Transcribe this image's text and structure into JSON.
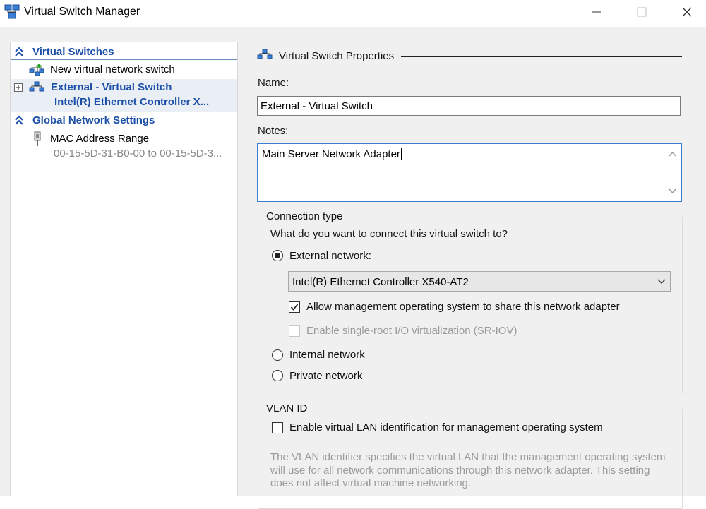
{
  "window": {
    "title": "Virtual Switch Manager",
    "controls": {
      "minimize_icon": "minimize-icon",
      "maximize_icon": "maximize-icon",
      "close_icon": "close-icon"
    }
  },
  "tree": {
    "virtual_switches_label": "Virtual Switches",
    "new_switch_label": "New virtual network switch",
    "switch": {
      "name": "External - Virtual Switch",
      "adapter": "Intel(R) Ethernet Controller X..."
    },
    "global_settings_label": "Global Network Settings",
    "mac_range": {
      "label": "MAC Address Range",
      "value": "00-15-5D-31-B0-00 to 00-15-5D-3..."
    }
  },
  "properties": {
    "header": "Virtual Switch Properties",
    "name_label": "Name:",
    "name_value": "External - Virtual Switch",
    "notes_label": "Notes:",
    "notes_value": "Main Server Network Adapter",
    "connection": {
      "title": "Connection type",
      "question": "What do you want to connect this virtual switch to?",
      "external_label": "External network:",
      "adapter_selected": "Intel(R) Ethernet Controller X540-AT2",
      "allow_mgmt_label": "Allow management operating system to share this network adapter",
      "sriov_label": "Enable single-root I/O virtualization (SR-IOV)",
      "internal_label": "Internal network",
      "private_label": "Private network",
      "selected": "external"
    },
    "vlan": {
      "title": "VLAN ID",
      "enable_label": "Enable virtual LAN identification for management operating system",
      "description": "The VLAN identifier specifies the virtual LAN that the management operating system will use for all network communications through this network adapter. This setting does not affect virtual machine networking."
    }
  },
  "colors": {
    "section_blue": "#1c4fa8",
    "focus_blue": "#3c7fd0",
    "disabled_gray": "#9b9b9b"
  }
}
